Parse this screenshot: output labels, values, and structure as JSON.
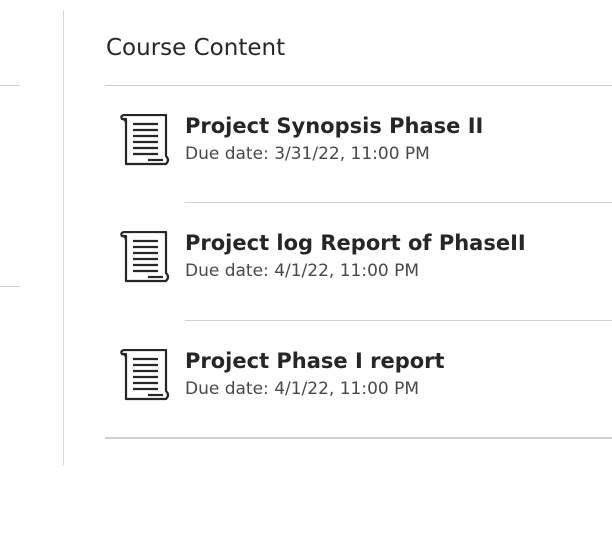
{
  "course_content": {
    "title": "Course Content",
    "items": [
      {
        "title": "Project Synopsis Phase II",
        "due": "Due date: 3/31/22, 11:00 PM",
        "icon": "document-icon"
      },
      {
        "title": "Project log Report of PhaseII",
        "due": "Due date: 4/1/22, 11:00 PM",
        "icon": "document-icon"
      },
      {
        "title": "Project Phase I report",
        "due": "Due date: 4/1/22, 11:00 PM",
        "icon": "document-icon"
      }
    ]
  }
}
